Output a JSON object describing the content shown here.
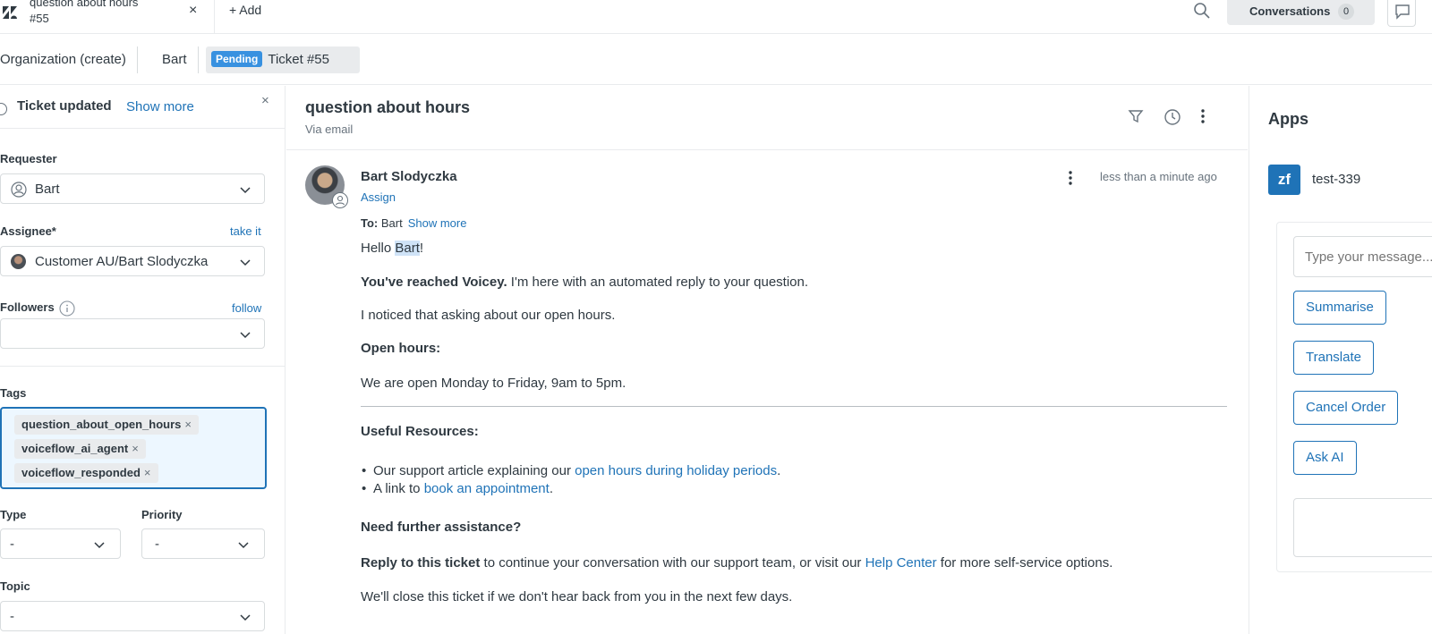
{
  "topbar": {
    "tab_title_line1": "question about hours",
    "tab_title_line2": "#55",
    "tab_close": "×",
    "add_label": "+ Add",
    "conversations_label": "Conversations",
    "conversations_count": "0"
  },
  "breadcrumb": {
    "organization": "Organization (create)",
    "user": "Bart",
    "status": "Pending",
    "ticket": "Ticket #55"
  },
  "left": {
    "notice_title": "Ticket updated",
    "notice_more": "Show more",
    "notice_close": "×",
    "requester_label": "Requester",
    "requester_value": "Bart",
    "assignee_label": "Assignee*",
    "assignee_action": "take it",
    "assignee_value": "Customer AU/Bart Slodyczka",
    "followers_label": "Followers",
    "followers_action": "follow",
    "tags_label": "Tags",
    "tags": [
      "question_about_open_hours",
      "voiceflow_ai_agent",
      "voiceflow_responded"
    ],
    "tag_remove": "×",
    "type_label": "Type",
    "type_value": "-",
    "priority_label": "Priority",
    "priority_value": "-",
    "topic_label": "Topic",
    "topic_value": "-"
  },
  "ticket": {
    "subject": "question about hours",
    "via": "Via email",
    "sender": "Bart Slodyczka",
    "assign": "Assign",
    "time": "less than a minute ago",
    "to_label": "To:",
    "to_value": "Bart",
    "to_more": "Show more",
    "greeting_pre": "Hello ",
    "greeting_name": "Bart",
    "greeting_post": "!",
    "intro_bold": "You've reached Voicey.",
    "intro_rest": " I'm here with an automated reply to your question.",
    "noticed": "I noticed that asking about our open hours.",
    "open_hours_heading": "Open hours:",
    "open_hours_text": "We are open Monday to Friday, 9am to 5pm.",
    "resources_heading": "Useful Resources:",
    "bullet1_pre": "Our support article explaining our ",
    "bullet1_link": "open hours during holiday periods",
    "bullet1_post": ".",
    "bullet2_pre": "A link to ",
    "bullet2_link": "book an appointment",
    "bullet2_post": ".",
    "assist_heading": "Need further assistance?",
    "reply_bold": "Reply to this ticket",
    "reply_mid": " to continue your conversation with our support team, or visit our ",
    "reply_link": "Help Center",
    "reply_post": " for more self-service options.",
    "close_note": "We'll close this ticket if we don't hear back from you in the next few days."
  },
  "apps": {
    "title": "Apps",
    "app_logo": "zf",
    "app_name": "test-339",
    "input_placeholder": "Type your message...",
    "buttons": [
      "Summarise",
      "Translate",
      "Cancel Order",
      "Ask AI"
    ]
  },
  "colors": {
    "accent": "#1f73b7",
    "pending_badge": "#3891e0",
    "highlight": "#cfe3f7"
  },
  "icons": [
    "zendesk-logo-icon",
    "search-icon",
    "chat-icon",
    "info-icon",
    "person-icon",
    "chevron-down-icon",
    "filter-icon",
    "history-icon",
    "kebab-icon"
  ]
}
